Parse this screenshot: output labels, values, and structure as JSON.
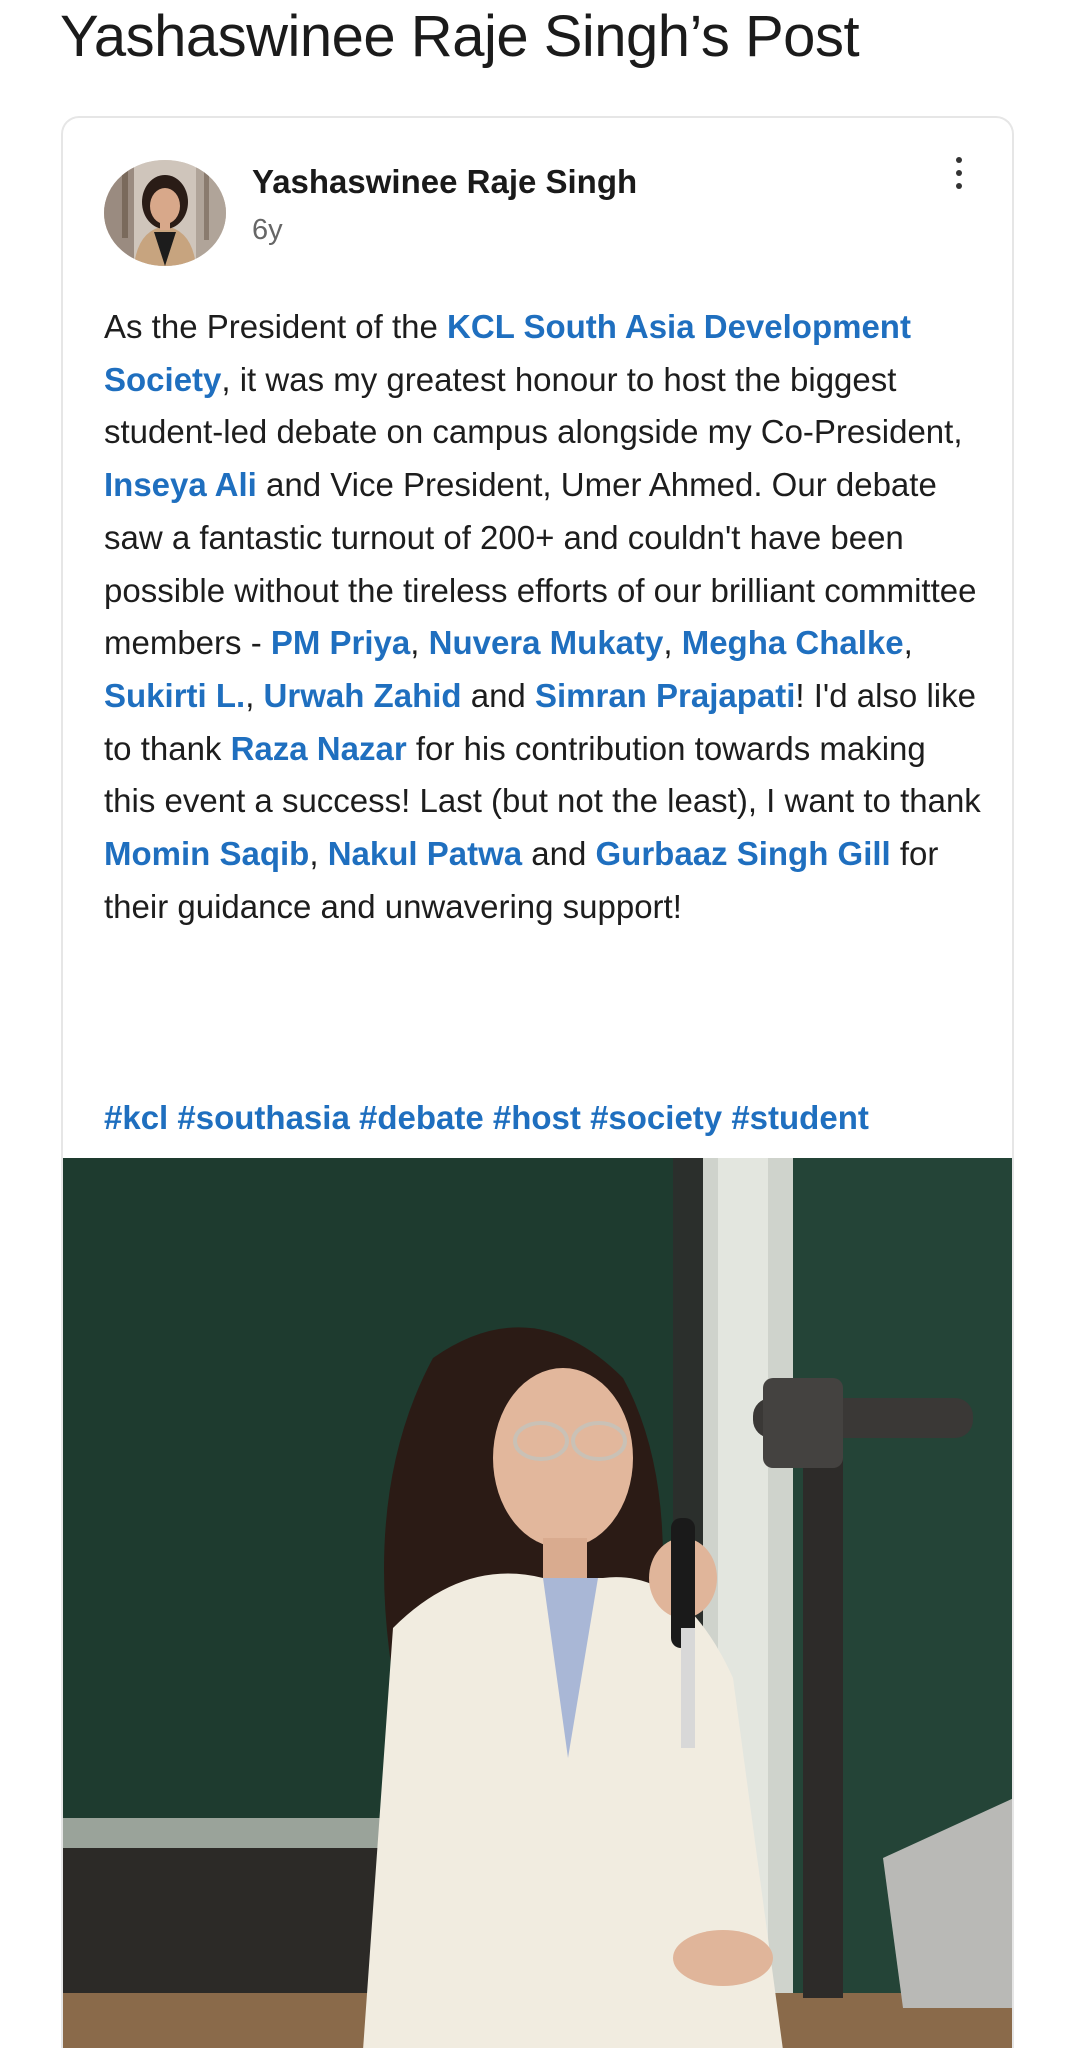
{
  "page": {
    "title": "Yashaswinee Raje Singh’s Post"
  },
  "post": {
    "author_name": "Yashaswinee Raje Singh",
    "age": "6y",
    "body": {
      "t1": "As the President of the ",
      "l1": "KCL South Asia Development Society",
      "t2": ", it was my greatest honour to host the biggest student-led debate on campus alongside my Co-President, ",
      "l2": "Inseya Ali",
      "t3": " and Vice President, Umer Ahmed. Our debate saw a fantastic turnout of 200+ and couldn't have been possible without the tireless efforts of our brilliant committee members - ",
      "l3": "PM Priya",
      "t4": ", ",
      "l4": "Nuvera Mukaty",
      "t5": ", ",
      "l5": "Megha Chalke",
      "t6": ", ",
      "l6": "Sukirti L.",
      "t7": ", ",
      "l7": "Urwah Zahid",
      "t8": " and ",
      "l8": "Simran Prajapati",
      "t9": "! I'd also like to thank ",
      "l9": "Raza Nazar",
      "t10": " for his contribution towards making this event a success! Last (but not the least), I want to thank ",
      "l10": "Momin Saqib",
      "t11": ", ",
      "l11": "Nakul Patwa",
      "t12": " and ",
      "l12": "Gurbaaz Singh Gill",
      "t13": " for their guidance and unwavering support!"
    },
    "hashtags": [
      "#kcl",
      "#southasia",
      "#debate",
      "#host",
      "#society",
      "#student"
    ]
  },
  "icons": {
    "more": "more-vertical-icon",
    "avatar": "avatar-photo",
    "image": "speaker-with-microphone-photo"
  },
  "colors": {
    "link": "#1f6fbf",
    "text": "#1d1d1d",
    "muted": "#666666",
    "card_border": "#e6e6e6"
  }
}
